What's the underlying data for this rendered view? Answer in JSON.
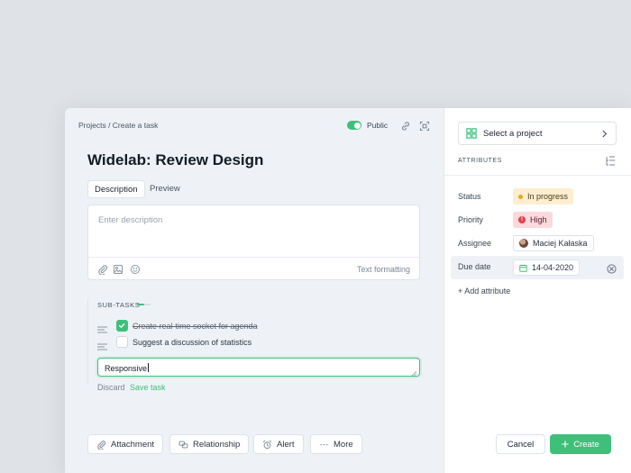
{
  "colors": {
    "accent": "#3ec07a",
    "status_dot": "#e7a61e",
    "priority_icon": "#e0414d"
  },
  "breadcrumb": "Projects / Create a task",
  "visibility": {
    "label": "Public",
    "on": true
  },
  "task": {
    "title": "Widelab: Review Design"
  },
  "tabs": [
    {
      "label": "Description",
      "active": true
    },
    {
      "label": "Preview",
      "active": false
    }
  ],
  "editor": {
    "placeholder": "Enter description",
    "text_formatting": "Text formatting",
    "icons": [
      "paperclip-icon",
      "image-icon",
      "emoji-icon"
    ]
  },
  "subtasks": {
    "label": "SUB-TASKS",
    "progress": 0.5,
    "items": [
      {
        "text": "Create real-time socket for agenda",
        "done": true
      },
      {
        "text": "Suggest a discussion of statistics",
        "done": false
      }
    ],
    "new_value": "Responsive",
    "discard": "Discard",
    "save": "Save task"
  },
  "actions": [
    {
      "label": "Attachment",
      "icon": "paperclip-icon"
    },
    {
      "label": "Relationship",
      "icon": "relationship-icon"
    },
    {
      "label": "Alert",
      "icon": "alarm-icon"
    },
    {
      "label": "More",
      "icon": "more-icon"
    }
  ],
  "sidebar": {
    "project_select": "Select a project",
    "attributes_label": "ATTRIBUTES",
    "status": {
      "label": "Status",
      "value": "In progress"
    },
    "priority": {
      "label": "Priority",
      "value": "High"
    },
    "assignee": {
      "label": "Assignee",
      "value": "Maciej Kałaska"
    },
    "due_date": {
      "label": "Due date",
      "value": "14-04-2020"
    },
    "add_attribute": "+ Add attribute"
  },
  "footer": {
    "cancel": "Cancel",
    "create": "Create"
  }
}
